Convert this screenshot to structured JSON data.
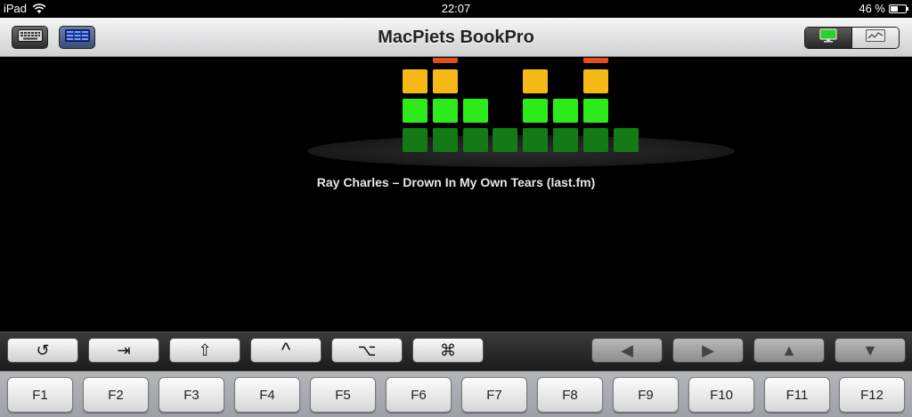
{
  "status": {
    "device": "iPad",
    "time": "22:07",
    "battery": "46 %",
    "battery_level": 0.46
  },
  "navbar": {
    "title": "MacPiets BookPro",
    "keyboard_button": "keyboard-icon",
    "grid_button": "grid-icon",
    "display_mode": "monitor-icon",
    "graph_mode": "graph-icon"
  },
  "visualizer": {
    "track": "Ray Charles – Drown In My Own Tears (last.fm)",
    "colors": {
      "orange": "#e0501c",
      "yellow": "#f6b915",
      "bright_green": "#2dea1a",
      "dark_green": "#137a15"
    }
  },
  "modifier_keys": [
    {
      "name": "rotate-key",
      "label": "↺",
      "icon": "rotate-icon"
    },
    {
      "name": "tab-key",
      "label": "⇥",
      "icon": "tab-icon"
    },
    {
      "name": "shift-key",
      "label": "⇧",
      "icon": "shift-icon"
    },
    {
      "name": "control-key",
      "label": "^",
      "icon": "control-icon"
    },
    {
      "name": "option-key",
      "label": "⌥",
      "icon": "option-icon"
    },
    {
      "name": "command-key",
      "label": "⌘",
      "icon": "command-icon"
    }
  ],
  "arrow_keys": [
    {
      "name": "left-arrow-key",
      "label": "◀",
      "icon": "left-arrow-icon"
    },
    {
      "name": "right-arrow-key",
      "label": "▶",
      "icon": "right-arrow-icon"
    },
    {
      "name": "up-arrow-key",
      "label": "▲",
      "icon": "up-arrow-icon"
    },
    {
      "name": "down-arrow-key",
      "label": "▼",
      "icon": "down-arrow-icon"
    }
  ],
  "function_keys": [
    "F1",
    "F2",
    "F3",
    "F4",
    "F5",
    "F6",
    "F7",
    "F8",
    "F9",
    "F10",
    "F11",
    "F12"
  ]
}
